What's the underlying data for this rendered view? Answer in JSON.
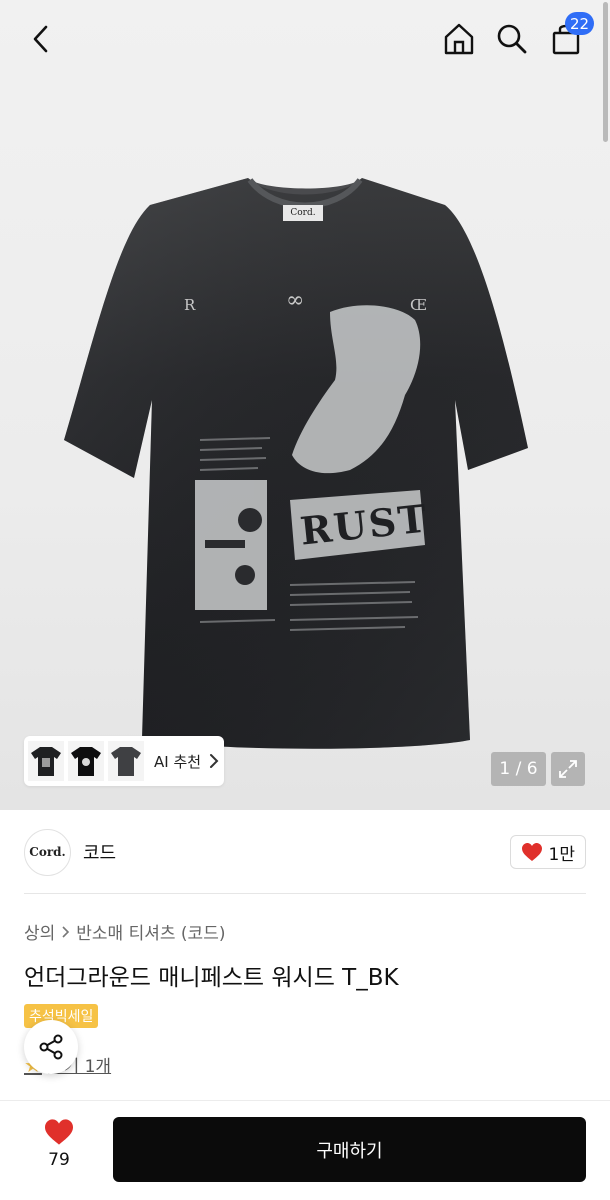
{
  "header": {
    "cart_count": "22"
  },
  "gallery": {
    "counter": "1 / 6",
    "ai_recommend_label": "AI 추천",
    "product_image_print": {
      "letter_left": "R",
      "infinity": "∞",
      "letter_right": "Œ",
      "brand_tag": "Cord.",
      "word": "RUST"
    }
  },
  "brand": {
    "logo_text": "Cord.",
    "name": "코드",
    "likes": "1만"
  },
  "breadcrumb": {
    "items": [
      "상의",
      "반소매 티셔츠 (코드)"
    ]
  },
  "product": {
    "title": "언더그라운드 매니페스트 워시드 T_BK",
    "sale_badge": "추석빅세일",
    "review_text": "후기 1개"
  },
  "bottom": {
    "wish_count": "79",
    "buy_label": "구매하기"
  },
  "colors": {
    "accent_blue": "#2f6df6",
    "sale_yellow": "#f6c245",
    "heart_red": "#e0302b",
    "buy_black": "#0b0b0b"
  }
}
